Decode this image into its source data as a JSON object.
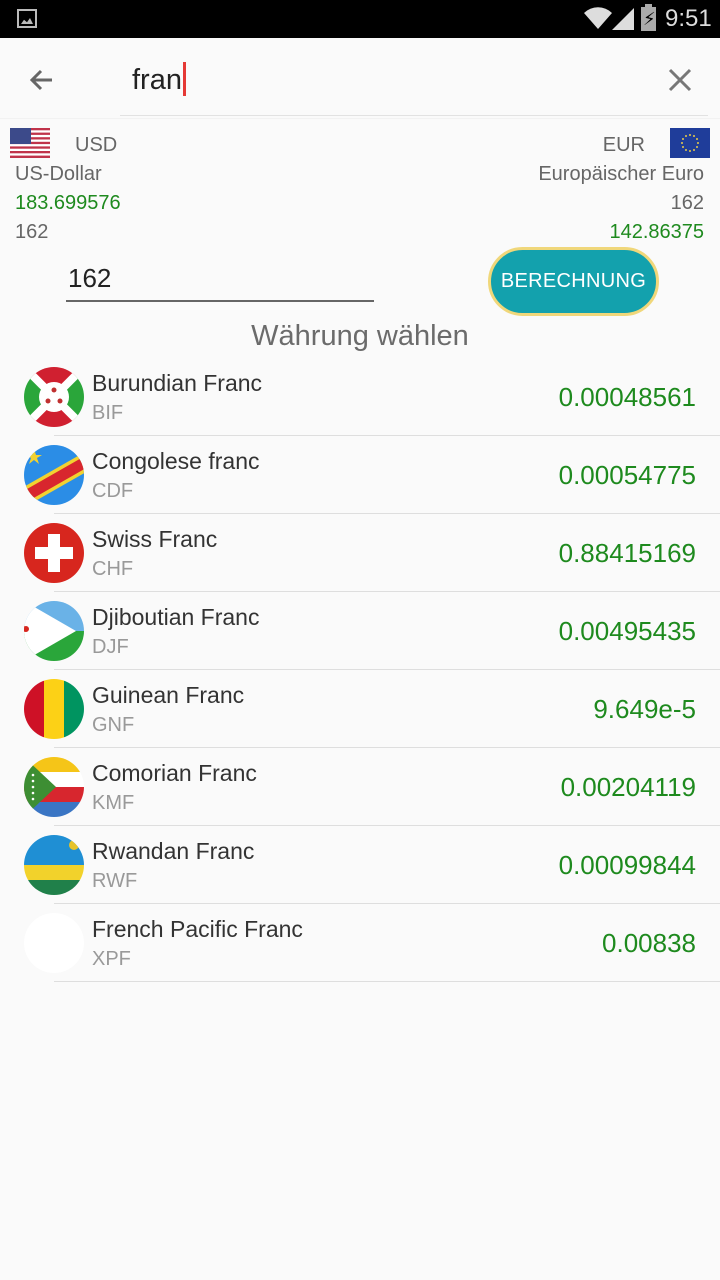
{
  "status_bar": {
    "time": "9:51",
    "icons": [
      "image-notification-icon",
      "wifi-icon",
      "signal-icon",
      "battery-charging-icon"
    ]
  },
  "search": {
    "query": "fran",
    "back_icon": "arrow-left-icon",
    "clear_icon": "close-icon"
  },
  "conversion": {
    "from": {
      "code": "USD",
      "name": "US-Dollar",
      "converted": "183.699576",
      "amount": "162",
      "flag": "us-flag"
    },
    "to": {
      "code": "EUR",
      "name": "Europäischer Euro",
      "amount": "162",
      "converted": "142.86375",
      "flag": "eu-flag"
    }
  },
  "amount_input": {
    "value": "162"
  },
  "calculate_button": {
    "label": "BERECHNUNG"
  },
  "section_title": "Währung wählen",
  "currencies": [
    {
      "name": "Burundian Franc",
      "code": "BIF",
      "rate": "0.00048561",
      "flag": "burundi-flag"
    },
    {
      "name": "Congolese franc",
      "code": "CDF",
      "rate": "0.00054775",
      "flag": "drc-flag"
    },
    {
      "name": "Swiss Franc",
      "code": "CHF",
      "rate": "0.88415169",
      "flag": "switzerland-flag"
    },
    {
      "name": "Djiboutian Franc",
      "code": "DJF",
      "rate": "0.00495435",
      "flag": "djibouti-flag"
    },
    {
      "name": "Guinean Franc",
      "code": "GNF",
      "rate": "9.649e-5",
      "flag": "guinea-flag"
    },
    {
      "name": "Comorian Franc",
      "code": "KMF",
      "rate": "0.00204119",
      "flag": "comoros-flag"
    },
    {
      "name": "Rwandan Franc",
      "code": "RWF",
      "rate": "0.00099844",
      "flag": "rwanda-flag"
    },
    {
      "name": "French Pacific Franc",
      "code": "XPF",
      "rate": "0.00838",
      "flag": "blank-flag"
    }
  ],
  "colors": {
    "accent_button": "#13a1ad",
    "button_border": "#f0d77a",
    "value_green": "#1e8a1e",
    "caret": "#e53935"
  }
}
